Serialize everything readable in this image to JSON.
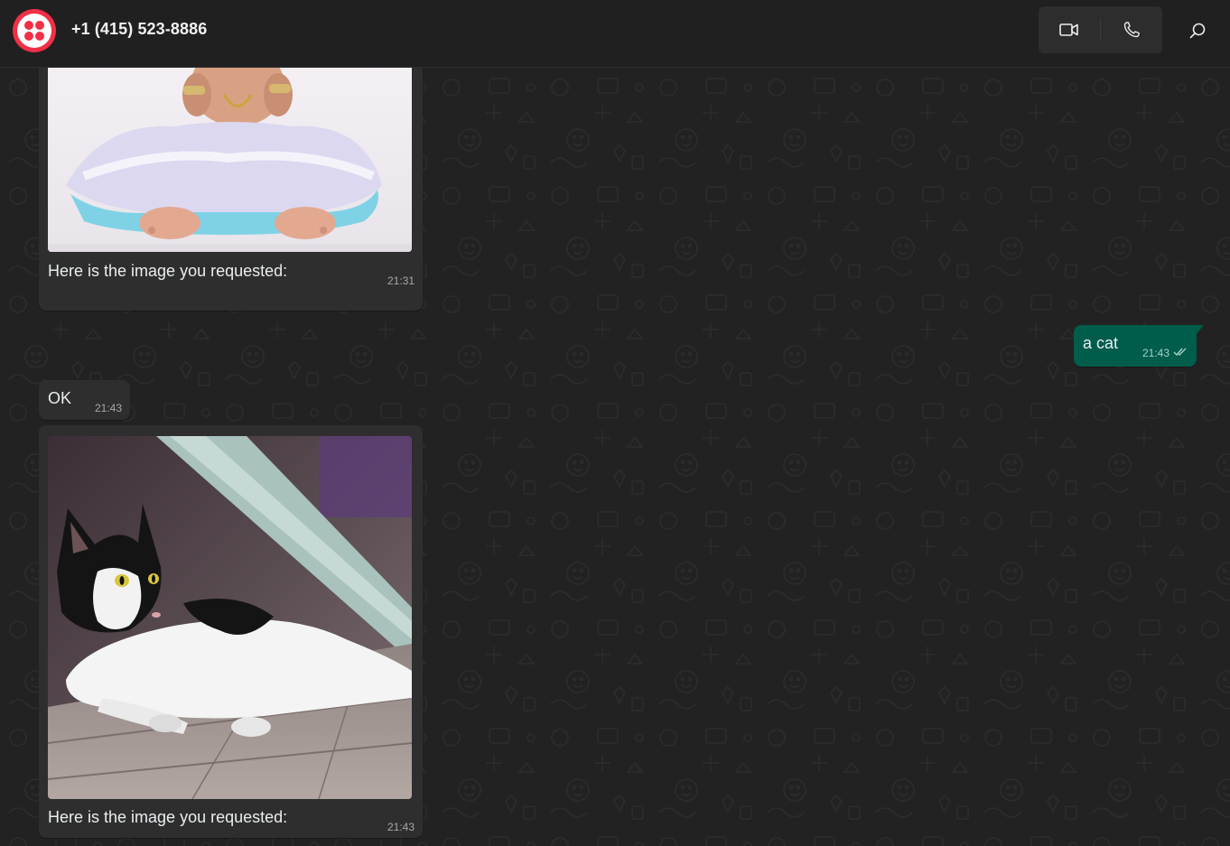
{
  "header": {
    "contact_name": "+1 (415) 523-8886",
    "avatar_color": "#f22f46",
    "video_call_icon": "video-camera-icon",
    "voice_call_icon": "phone-icon",
    "search_icon": "search-icon"
  },
  "messages": [
    {
      "direction": "incoming",
      "type": "image",
      "image": "baby-photo",
      "caption": "Here is the image you requested:",
      "time": "21:31"
    },
    {
      "direction": "outgoing",
      "type": "text",
      "text": "a cat",
      "time": "21:43",
      "status_icon": "double-check-icon"
    },
    {
      "direction": "incoming",
      "type": "text",
      "text": "OK",
      "time": "21:43"
    },
    {
      "direction": "incoming",
      "type": "image",
      "image": "cat-photo",
      "caption": "Here is the image you requested:",
      "time": "21:43"
    }
  ],
  "colors": {
    "incoming_bubble": "#2e2e2e",
    "outgoing_bubble": "#005c4b",
    "background": "#222222",
    "header": "#202020"
  }
}
